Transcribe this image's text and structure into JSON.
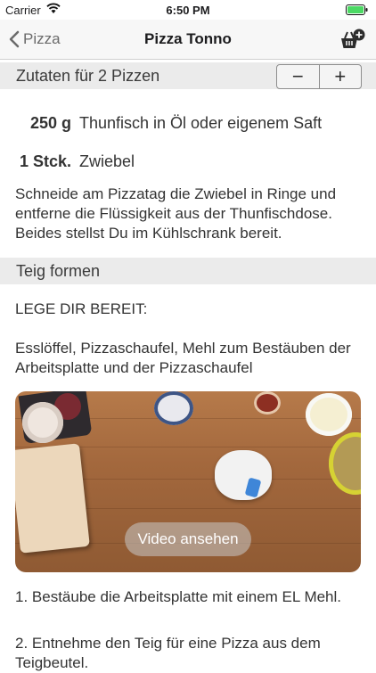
{
  "status_bar": {
    "carrier": "Carrier",
    "time": "6:50 PM"
  },
  "nav": {
    "back_label": "Pizza",
    "title": "Pizza Tonno"
  },
  "ingredients_section": {
    "title": "Zutaten für 2 Pizzen",
    "minus": "−",
    "plus": "+"
  },
  "ingredients": [
    {
      "amount": "250 g",
      "name": "Thunfisch in Öl oder eigenem Saft"
    },
    {
      "amount": "1 Stck.",
      "name": "Zwiebel"
    }
  ],
  "prep_text": "Schneide am Pizzatag die Zwiebel in Ringe und entferne die Flüssigkeit aus der Thunfischdose. Beides stellst Du im Kühlschrank bereit.",
  "dough_section": {
    "title": "Teig formen"
  },
  "prepare_heading": "LEGE DIR BEREIT:",
  "tools_text": "Esslöffel, Pizzaschaufel, Mehl zum Bestäuben der Arbeitsplatte und der Pizzaschaufel",
  "video": {
    "button_label": "Video ansehen"
  },
  "steps": [
    "1. Bestäube die Arbeitsplatte mit einem EL Mehl.",
    "2. Entnehme den Teig für eine Pizza aus dem Teigbeutel."
  ]
}
